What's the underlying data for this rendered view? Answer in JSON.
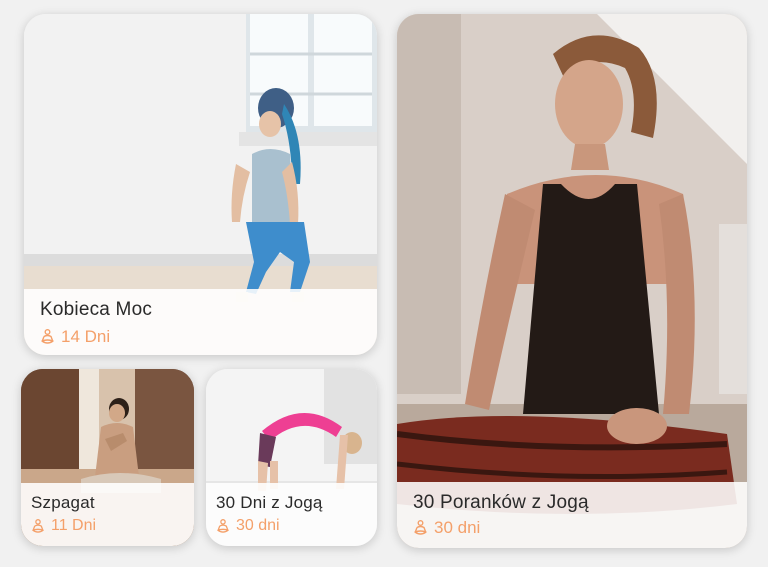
{
  "programs": [
    {
      "title": "Kobieca Moc",
      "duration": "14 Dni",
      "icon": "meditation-icon"
    },
    {
      "title": "Szpagat",
      "duration": "11 Dni",
      "icon": "meditation-icon"
    },
    {
      "title": "30 Dni z Jogą",
      "duration": "30 dni",
      "icon": "meditation-icon"
    },
    {
      "title": "30 Poranków z Jogą",
      "duration": "30 dni",
      "icon": "meditation-icon"
    }
  ],
  "colors": {
    "accent": "#f4a06a",
    "title_text": "#2a2a2a",
    "background": "#f1f1f1"
  }
}
